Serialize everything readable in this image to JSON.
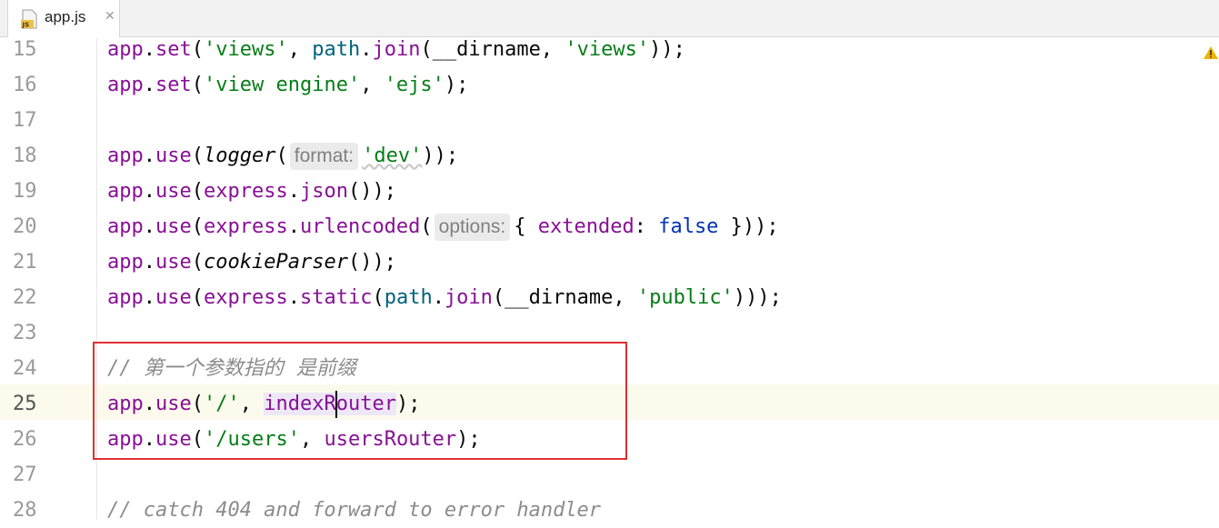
{
  "tab": {
    "title": "app.js",
    "close": "✕",
    "icon_label": "JS"
  },
  "lines": [
    {
      "no": "15"
    },
    {
      "no": "16"
    },
    {
      "no": "17"
    },
    {
      "no": "18"
    },
    {
      "no": "19"
    },
    {
      "no": "20"
    },
    {
      "no": "21"
    },
    {
      "no": "22"
    },
    {
      "no": "23"
    },
    {
      "no": "24"
    },
    {
      "no": "25"
    },
    {
      "no": "26"
    },
    {
      "no": "27"
    },
    {
      "no": "28"
    }
  ],
  "code": {
    "l15": {
      "obj": "app",
      "dot": ".",
      "m": "set",
      "p1": "(",
      "s1": "'views'",
      "comma": ", ",
      "f1": "path",
      "dot2": ".",
      "m2": "join",
      "p2": "(__dirname, ",
      "s2": "'views'",
      "end": "));"
    },
    "l16": {
      "obj": "app",
      "dot": ".",
      "m": "set",
      "p1": "(",
      "s1": "'view engine'",
      "comma": ", ",
      "s2": "'ejs'",
      "end": ");"
    },
    "l18": {
      "obj": "app",
      "dot": ".",
      "m": "use",
      "p1": "(",
      "fn": "logger",
      "p2": "(",
      "hint": "format:",
      "s1": "'dev'",
      "end": "));"
    },
    "l19": {
      "obj": "app",
      "dot": ".",
      "m": "use",
      "p1": "(",
      "o2": "express",
      "dot2": ".",
      "m2": "json",
      "end": "());"
    },
    "l20": {
      "obj": "app",
      "dot": ".",
      "m": "use",
      "p1": "(",
      "o2": "express",
      "dot2": ".",
      "m2": "urlencoded",
      "p2": "(",
      "hint": "options:",
      "b1": "{ ",
      "prop": "extended",
      "colon": ": ",
      "kw": "false",
      "end": " }));"
    },
    "l21": {
      "obj": "app",
      "dot": ".",
      "m": "use",
      "p1": "(",
      "fn": "cookieParser",
      "end": "());"
    },
    "l22": {
      "obj": "app",
      "dot": ".",
      "m": "use",
      "p1": "(",
      "o2": "express",
      "dot2": ".",
      "m2": "static",
      "p2": "(",
      "f1": "path",
      "dot3": ".",
      "m3": "join",
      "p3": "(__dirname, ",
      "s1": "'public'",
      "end": ")));"
    },
    "l24": {
      "comment_slash": "// ",
      "comment_text": "第一个参数指的  是前缀"
    },
    "l25": {
      "obj": "app",
      "dot": ".",
      "m": "use",
      "p1": "(",
      "s1": "'/'",
      "comma": ", ",
      "v1": "indexR",
      "v2": "outer",
      "end": ");"
    },
    "l26": {
      "obj": "app",
      "dot": ".",
      "m": "use",
      "p1": "(",
      "s1": "'/users'",
      "comma": ", ",
      "v1": "usersRouter",
      "end": ");"
    },
    "l28": {
      "comment": "// catch 404 and forward to error handler"
    }
  },
  "colors": {
    "highlight_box": "#e03030",
    "string": "#067d17",
    "member": "#871094",
    "keyword": "#0033b3",
    "comment": "#8c8c8c"
  }
}
